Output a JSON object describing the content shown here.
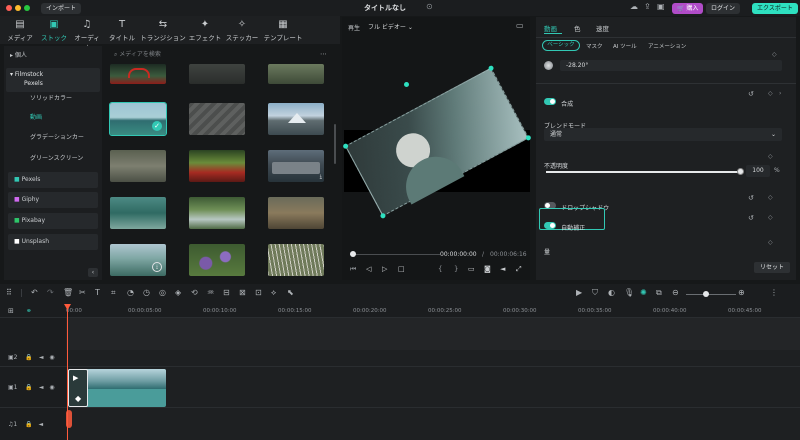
{
  "titlebar": {
    "import": "インポート",
    "title": "タイトルなし",
    "buy": "購入",
    "login": "ログイン",
    "export": "エクスポート"
  },
  "media_tabs": [
    {
      "label": "メディア",
      "icon": "media-icon"
    },
    {
      "label": "ストック",
      "icon": "stock-icon"
    },
    {
      "label": "オーディオ",
      "icon": "audio-icon"
    },
    {
      "label": "タイトル",
      "icon": "title-icon"
    },
    {
      "label": "トランジション",
      "icon": "transition-icon"
    },
    {
      "label": "エフェクト",
      "icon": "effect-icon"
    },
    {
      "label": "ステッカー",
      "icon": "sticker-icon"
    },
    {
      "label": "テンプレート",
      "icon": "template-icon"
    }
  ],
  "sidebar": {
    "personal": "個人",
    "fs_line1": "Filmstock",
    "fs_line2": "Pexels",
    "solid": "ソリッドカラー",
    "video": "動画",
    "gradient": "グラデーションカー",
    "green": "グリーンスクリーン",
    "pexels": "Pexels",
    "giphy": "Giphy",
    "pixabay": "Pixabay",
    "unsplash": "Unsplash"
  },
  "search": {
    "placeholder": "メディアを検索"
  },
  "preview": {
    "play_label": "再生",
    "quality": "フル ビデオー",
    "time_current": "00:00:00:00",
    "time_sep": "/",
    "time_total": "00:00:06:16"
  },
  "props": {
    "tabs": [
      "動画",
      "色",
      "速度"
    ],
    "subtabs": [
      "ベーシック",
      "マスク",
      "AI ツール",
      "アニメーション"
    ],
    "rotate": "-28.20°",
    "composite": "合成",
    "blend_label": "ブレンドモード",
    "blend_value": "通常",
    "opacity_label": "不透明度",
    "opacity_value": "100",
    "opacity_unit": "%",
    "opacity": 1.0,
    "drop_shadow": "ドロップシャドウ",
    "auto_correct": "自動補正",
    "more": "量",
    "reset": "リセット"
  },
  "ruler": [
    "00:00",
    "00:00:05:00",
    "00:00:10:00",
    "00:00:15:00",
    "00:00:20:00",
    "00:00:25:00",
    "00:00:30:00",
    "00:00:35:00",
    "00:00:40:00",
    "00:00:45:00"
  ],
  "tracks": [
    {
      "num": "2"
    },
    {
      "num": "1"
    },
    {
      "num": "1"
    }
  ],
  "colors": {
    "accent": "#32c8b4",
    "buy": "#b04cc8",
    "playhead": "#ff5a3c",
    "video_track": "#4a9c9a"
  }
}
